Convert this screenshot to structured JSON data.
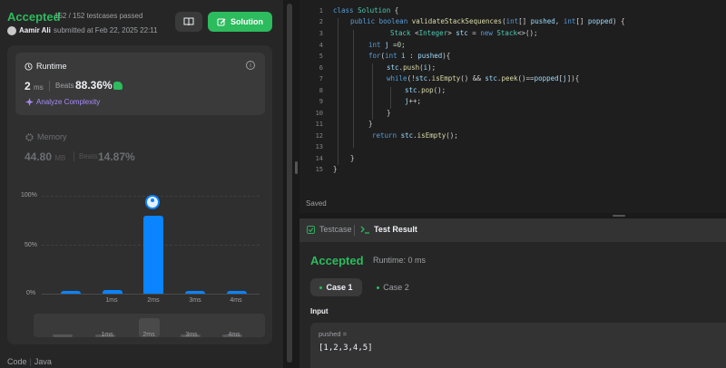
{
  "header": {
    "status": "Accepted",
    "passed": "152 / 152 testcases passed",
    "solution_label": "Solution",
    "author": "Aamir Ali",
    "submitted": "submitted at Feb 22, 2025 22:11"
  },
  "runtime": {
    "title": "Runtime",
    "value": "2",
    "unit": "ms",
    "beats_label": "Beats",
    "beats_pct": "88.36%",
    "analyze_label": "Analyze Complexity"
  },
  "memory": {
    "title": "Memory",
    "value": "44.80",
    "unit": "MB",
    "beats_label": "Beats",
    "beats_pct": "14.87%"
  },
  "chart_data": {
    "type": "bar",
    "yticks": [
      "100%",
      "50%",
      "0%"
    ],
    "ylim": [
      0,
      100
    ],
    "x_labels": [
      "1ms",
      "2ms",
      "3ms",
      "4ms"
    ],
    "bars": [
      {
        "x": "0ms",
        "value": 3
      },
      {
        "x": "1ms",
        "value": 4
      },
      {
        "x": "2ms",
        "value": 80,
        "highlighted": true
      },
      {
        "x": "3ms",
        "value": 3
      },
      {
        "x": "4ms",
        "value": 3
      }
    ],
    "bar_color": "#0a84ff",
    "brush_labels": [
      "1ms",
      "2ms",
      "3ms",
      "4ms"
    ]
  },
  "code_tab": {
    "code": "Code",
    "lang": "Java"
  },
  "editor": {
    "line_numbers": [
      "1",
      "2",
      "3",
      "4",
      "5",
      "6",
      "7",
      "8",
      "9",
      "10",
      "11",
      "12",
      "13",
      "14",
      "15"
    ],
    "saved": "Saved"
  },
  "test_panel": {
    "tab_testcase": "Testcase",
    "tab_result": "Test Result",
    "status": "Accepted",
    "runtime": "Runtime: 0 ms",
    "case1": "Case 1",
    "case2": "Case 2",
    "input_label": "Input",
    "param_name": "pushed =",
    "param_value": "[1,2,3,4,5]"
  },
  "colors": {
    "accent_green": "#2cbb5d",
    "bar_blue": "#0a84ff",
    "analyze_purple": "#a78bfa"
  }
}
